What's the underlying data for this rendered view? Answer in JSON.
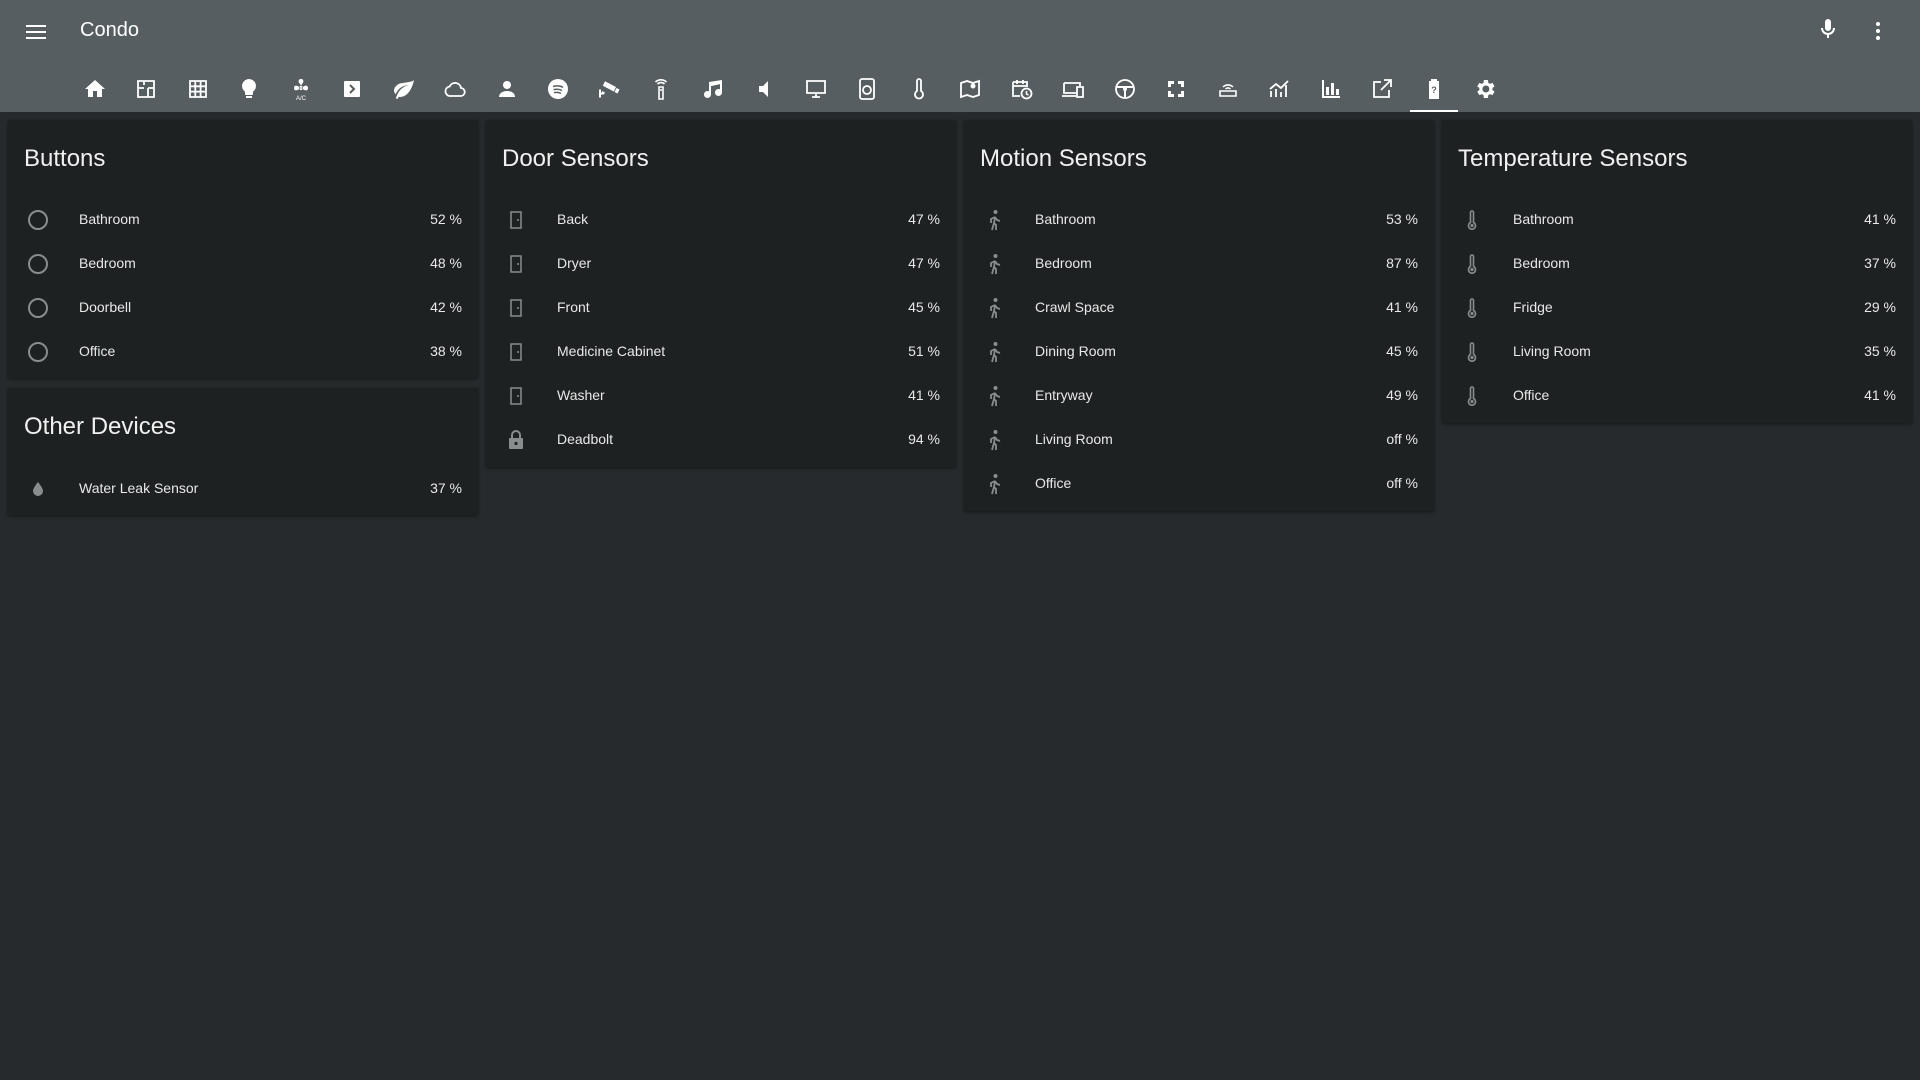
{
  "app": {
    "title": "Condo"
  },
  "colors": {
    "header": "#575e61",
    "background": "#262a2c",
    "card": "#1e2122",
    "icon": "#8a8d8e"
  },
  "tabs": [
    {
      "icon": "home-icon"
    },
    {
      "icon": "floorplan-icon"
    },
    {
      "icon": "grid-icon"
    },
    {
      "icon": "lightbulb-icon"
    },
    {
      "icon": "fan-ac-icon"
    },
    {
      "icon": "script-icon"
    },
    {
      "icon": "leaf-icon"
    },
    {
      "icon": "cloud-icon"
    },
    {
      "icon": "person-icon"
    },
    {
      "icon": "spotify-icon"
    },
    {
      "icon": "cctv-icon"
    },
    {
      "icon": "remote-icon"
    },
    {
      "icon": "music-note-icon"
    },
    {
      "icon": "speaker-icon"
    },
    {
      "icon": "monitor-icon"
    },
    {
      "icon": "washer-icon"
    },
    {
      "icon": "thermometer-icon"
    },
    {
      "icon": "map-icon"
    },
    {
      "icon": "calendar-clock-icon"
    },
    {
      "icon": "devices-icon"
    },
    {
      "icon": "steering-wheel-icon"
    },
    {
      "icon": "fullscreen-icon"
    },
    {
      "icon": "router-icon"
    },
    {
      "icon": "line-chart-icon"
    },
    {
      "icon": "bar-chart-icon"
    },
    {
      "icon": "open-in-new-icon"
    },
    {
      "icon": "battery-icon"
    },
    {
      "icon": "gear-icon"
    }
  ],
  "cards": {
    "buttons": {
      "title": "Buttons",
      "rows": [
        {
          "name": "Bathroom",
          "value": "52 %"
        },
        {
          "name": "Bedroom",
          "value": "48 %"
        },
        {
          "name": "Doorbell",
          "value": "42 %"
        },
        {
          "name": "Office",
          "value": "38 %"
        }
      ]
    },
    "other": {
      "title": "Other Devices",
      "rows": [
        {
          "name": "Water Leak Sensor",
          "value": "37 %"
        }
      ]
    },
    "door": {
      "title": "Door Sensors",
      "rows": [
        {
          "name": "Back",
          "value": "47 %"
        },
        {
          "name": "Dryer",
          "value": "47 %"
        },
        {
          "name": "Front",
          "value": "45 %"
        },
        {
          "name": "Medicine Cabinet",
          "value": "51 %"
        },
        {
          "name": "Washer",
          "value": "41 %"
        },
        {
          "name": "Deadbolt",
          "value": "94 %"
        }
      ]
    },
    "motion": {
      "title": "Motion Sensors",
      "rows": [
        {
          "name": "Bathroom",
          "value": "53 %"
        },
        {
          "name": "Bedroom",
          "value": "87 %"
        },
        {
          "name": "Crawl Space",
          "value": "41 %"
        },
        {
          "name": "Dining Room",
          "value": "45 %"
        },
        {
          "name": "Entryway",
          "value": "49 %"
        },
        {
          "name": "Living Room",
          "value": "off %"
        },
        {
          "name": "Office",
          "value": "off %"
        }
      ]
    },
    "temperature": {
      "title": "Temperature Sensors",
      "rows": [
        {
          "name": "Bathroom",
          "value": "41 %"
        },
        {
          "name": "Bedroom",
          "value": "37 %"
        },
        {
          "name": "Fridge",
          "value": "29 %"
        },
        {
          "name": "Living Room",
          "value": "35 %"
        },
        {
          "name": "Office",
          "value": "41 %"
        }
      ]
    }
  }
}
